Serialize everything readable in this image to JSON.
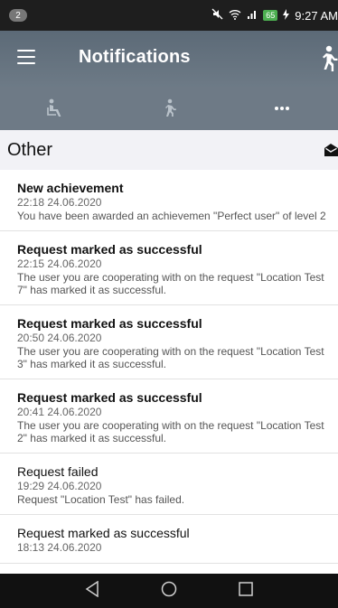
{
  "status_bar": {
    "notification_count": "2",
    "battery": "65",
    "time": "9:27 AM"
  },
  "app_bar": {
    "title": "Notifications"
  },
  "tabs": [
    {
      "name": "sitting-person-icon"
    },
    {
      "name": "walking-person-icon"
    },
    {
      "name": "more-icon"
    }
  ],
  "section": {
    "title": "Other"
  },
  "notifications": [
    {
      "title": "New achievement",
      "bold": true,
      "date": "22:18 24.06.2020",
      "body": "You have been awarded an achievemen \"Perfect user\" of level 2"
    },
    {
      "title": "Request marked as successful",
      "bold": true,
      "date": "22:15 24.06.2020",
      "body": "The user you are cooperating with on the request \"Location Test\n7\" has marked it as successful."
    },
    {
      "title": "Request marked as successful",
      "bold": true,
      "date": "20:50 24.06.2020",
      "body": "The user you are cooperating with on the request \"Location Test\n3\" has marked it as successful."
    },
    {
      "title": "Request marked as successful",
      "bold": true,
      "date": "20:41 24.06.2020",
      "body": "The user you are cooperating with on the request \"Location Test\n2\" has marked it as successful."
    },
    {
      "title": "Request failed",
      "bold": false,
      "date": "19:29 24.06.2020",
      "body": "Request \"Location Test\" has failed."
    },
    {
      "title": "Request marked as successful",
      "bold": false,
      "date": "18:13 24.06.2020",
      "body": ""
    }
  ],
  "colors": {
    "app_bar": "#5c6a77",
    "tab_bar": "#6e7a86",
    "section_bg": "#f2f2f6",
    "battery": "#4caf50"
  }
}
